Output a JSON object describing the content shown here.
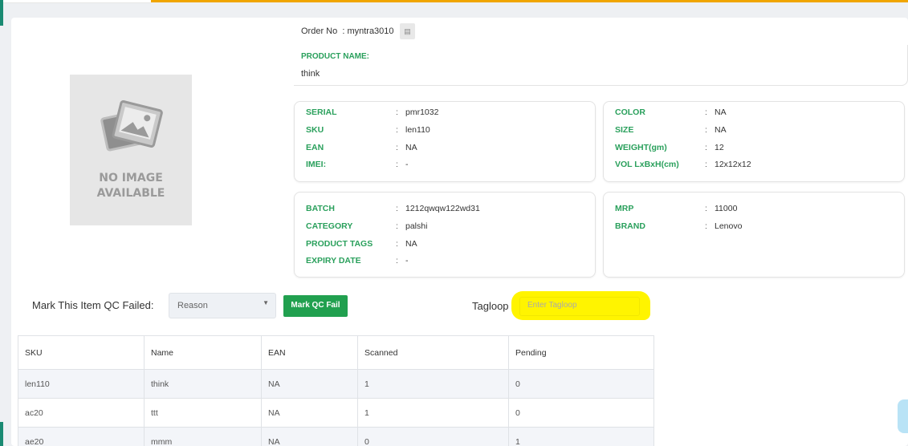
{
  "image": {
    "no_image_text_line1": "NO IMAGE",
    "no_image_text_line2": "AVAILABLE"
  },
  "order": {
    "label": "Order No",
    "separator": ":",
    "value": "myntra3010"
  },
  "product_name": {
    "label": "PRODUCT NAME:",
    "value": "think"
  },
  "details_a": [
    {
      "label": "SERIAL",
      "value": "pmr1032"
    },
    {
      "label": "SKU",
      "value": "len110"
    },
    {
      "label": "EAN",
      "value": "NA"
    },
    {
      "label": "IMEI:",
      "value": "-"
    }
  ],
  "details_b": [
    {
      "label": "COLOR",
      "value": "NA"
    },
    {
      "label": "SIZE",
      "value": "NA"
    },
    {
      "label": "WEIGHT(gm)",
      "value": "12"
    },
    {
      "label": "VOL LxBxH(cm)",
      "value": "12x12x12"
    }
  ],
  "details_c": [
    {
      "label": "BATCH",
      "value": "1212qwqw122wd31"
    },
    {
      "label": "CATEGORY",
      "value": "palshi"
    },
    {
      "label": "PRODUCT TAGS",
      "value": "NA"
    },
    {
      "label": "EXPIRY DATE",
      "value": "-"
    }
  ],
  "details_d": [
    {
      "label": "MRP",
      "value": "11000"
    },
    {
      "label": "BRAND",
      "value": "Lenovo"
    }
  ],
  "colon": ":",
  "qc": {
    "label": "Mark This Item QC Failed:",
    "reason_placeholder": "Reason",
    "button_label": "Mark QC Fail"
  },
  "tagloop": {
    "label": "Tagloop",
    "placeholder": "Enter Tagloop"
  },
  "table": {
    "headers": [
      "SKU",
      "Name",
      "EAN",
      "Scanned",
      "Pending"
    ],
    "rows": [
      [
        "len110",
        "think",
        "NA",
        "1",
        "0"
      ],
      [
        "ac20",
        "ttt",
        "NA",
        "1",
        "0"
      ],
      [
        "ae20",
        "mmm",
        "NA",
        "0",
        "1"
      ]
    ]
  },
  "colors": {
    "accent_green": "#2aa05c",
    "button_green": "#21a04f",
    "highlight_yellow": "#fff400",
    "top_bar_orange": "#f0a500"
  }
}
